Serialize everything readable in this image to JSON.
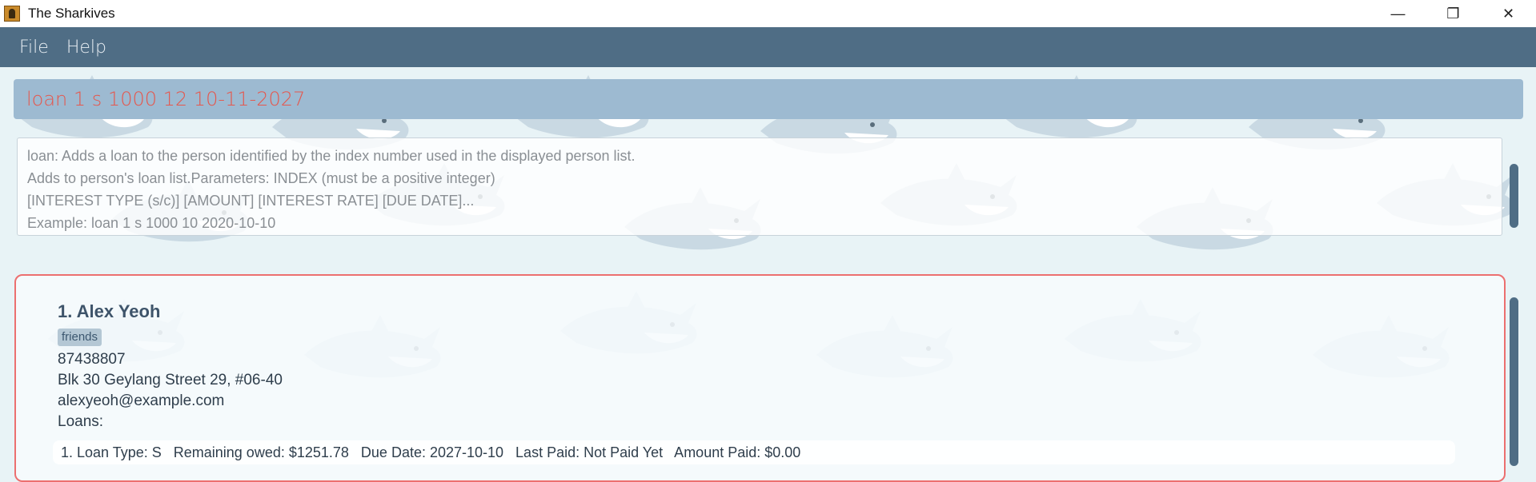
{
  "window": {
    "title": "The Sharkives",
    "controls": {
      "minimize": "—",
      "restore": "❐",
      "close": "✕"
    }
  },
  "menu": {
    "items": [
      "File",
      "Help"
    ]
  },
  "command_box": {
    "value": "loan 1 s 1000 12 10-11-2027"
  },
  "result_display": {
    "lines": [
      "loan: Adds a loan to the person identified by the index number used in the displayed person list.",
      "Adds to person's loan list.Parameters: INDEX (must be a positive integer)",
      "[INTEREST TYPE (s/c)] [AMOUNT] [INTEREST RATE] [DUE DATE]...",
      "Example: loan 1 s 1000 10 2020-10-10"
    ]
  },
  "person": {
    "index_name": "1.  Alex Yeoh",
    "tag": "friends",
    "phone": "87438807",
    "address": "Blk 30 Geylang Street 29, #06-40",
    "email": "alexyeoh@example.com",
    "loans_label": "Loans:",
    "loans": [
      "1. Loan Type: S   Remaining owed: $1251.78   Due Date: 2027-10-10   Last Paid: Not Paid Yet   Amount Paid: $0.00"
    ]
  },
  "colors": {
    "menubar": "#4f6d85",
    "command_box": "#9dbad1",
    "command_text": "#e5574d",
    "selected_border": "#ec6f6f",
    "scrollbar": "#4f6d85"
  },
  "icons": {
    "app": "sharkives-app-icon",
    "background": "shark-pattern"
  }
}
